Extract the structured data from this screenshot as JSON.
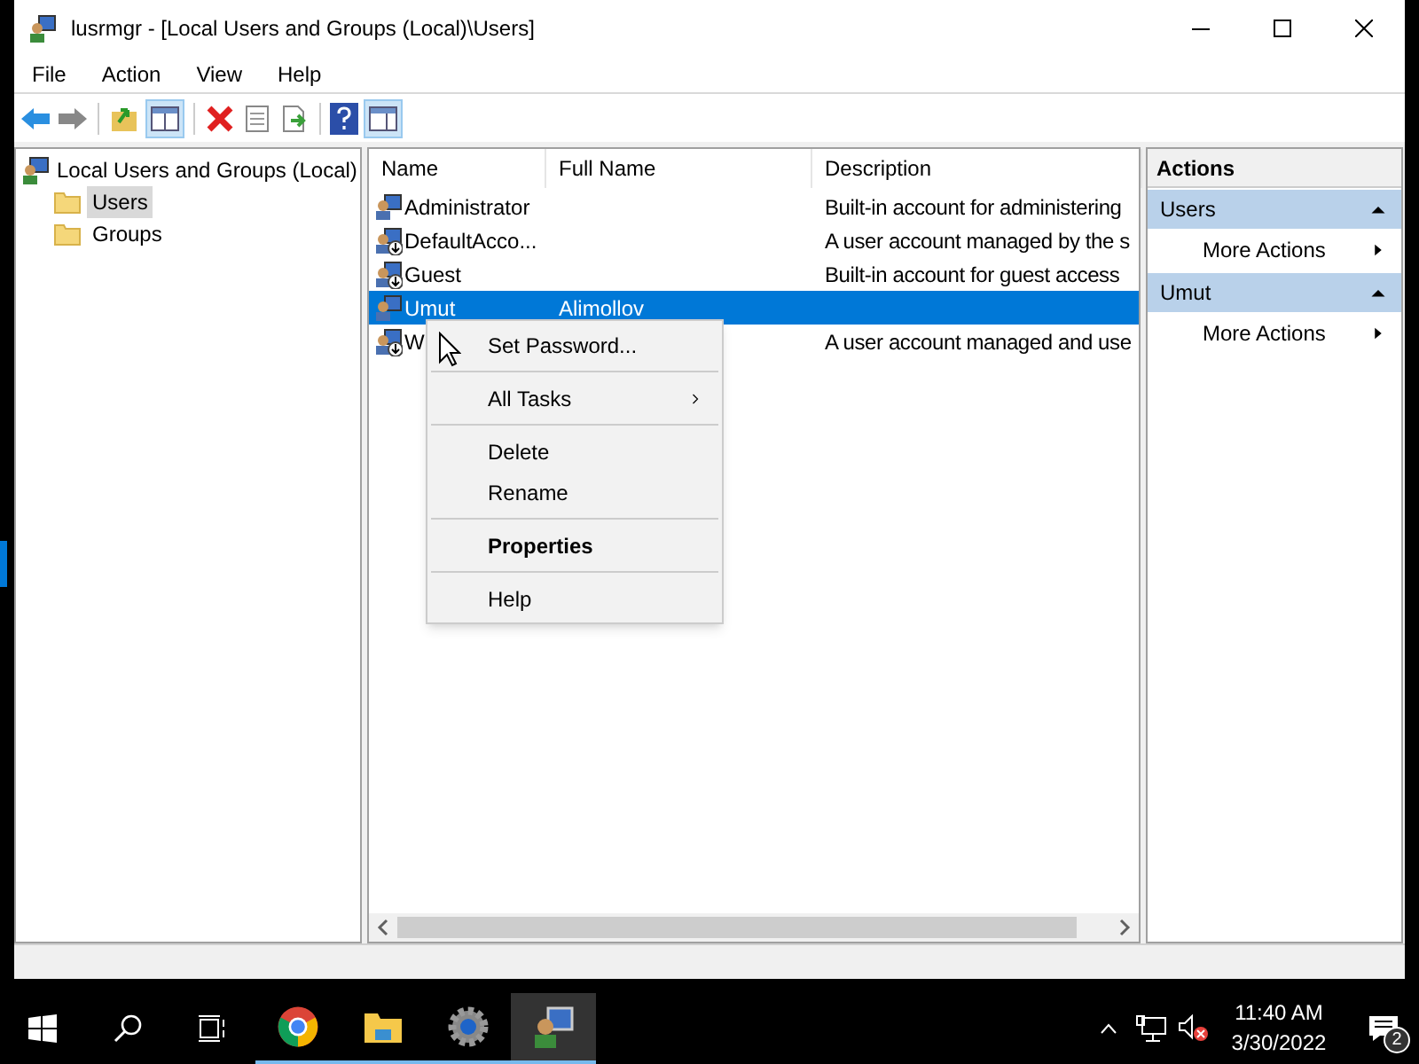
{
  "window": {
    "title": "lusrmgr - [Local Users and Groups (Local)\\Users]"
  },
  "menu": [
    "File",
    "Action",
    "View",
    "Help"
  ],
  "tree": {
    "label": "Local Users and Groups (Local)",
    "children": [
      {
        "label": "Users",
        "selected": true
      },
      {
        "label": "Groups",
        "selected": false
      }
    ]
  },
  "list": {
    "columns": [
      "Name",
      "Full Name",
      "Description"
    ],
    "rows": [
      {
        "name": "Administrator",
        "full_name": "",
        "description": "Built-in account for administering",
        "selected": false,
        "disabled": false
      },
      {
        "name": "DefaultAcco...",
        "full_name": "",
        "description": "A user account managed by the s",
        "selected": false,
        "disabled": true
      },
      {
        "name": "Guest",
        "full_name": "",
        "description": "Built-in account for guest access",
        "selected": false,
        "disabled": true
      },
      {
        "name": "Umut",
        "full_name": "Alimollov",
        "description": "",
        "selected": true,
        "disabled": false
      },
      {
        "name": "W",
        "full_name": "",
        "description": "A user account managed and use",
        "selected": false,
        "disabled": true
      }
    ]
  },
  "context_menu": [
    {
      "label": "Set Password...",
      "kind": "item",
      "bold": false,
      "separator_after": true
    },
    {
      "label": "All Tasks",
      "kind": "submenu",
      "bold": false,
      "separator_after": true
    },
    {
      "label": "Delete",
      "kind": "item",
      "bold": false,
      "separator_after": false
    },
    {
      "label": "Rename",
      "kind": "item",
      "bold": false,
      "separator_after": true
    },
    {
      "label": "Properties",
      "kind": "item",
      "bold": true,
      "separator_after": true
    },
    {
      "label": "Help",
      "kind": "item",
      "bold": false,
      "separator_after": false
    }
  ],
  "actions": {
    "title": "Actions",
    "sections": [
      {
        "title": "Users",
        "items": [
          "More Actions"
        ]
      },
      {
        "title": "Umut",
        "items": [
          "More Actions"
        ]
      }
    ]
  },
  "taskbar": {
    "apps": [
      {
        "kind": "chrome",
        "selected": false
      },
      {
        "kind": "folder",
        "selected": false
      },
      {
        "kind": "gear",
        "selected": false
      },
      {
        "kind": "users",
        "selected": true
      }
    ],
    "time": "11:40 AM",
    "date": "3/30/2022",
    "notifications": "2"
  }
}
